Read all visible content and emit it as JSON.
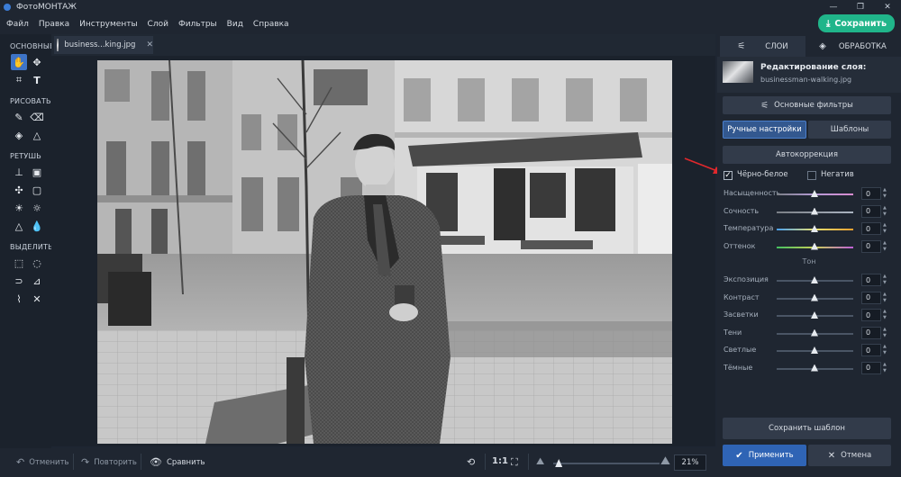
{
  "window": {
    "title": "ФотоМОНТАЖ",
    "controls": [
      "—",
      "❐",
      "✕"
    ]
  },
  "menu": {
    "items": [
      "Файл",
      "Правка",
      "Инструменты",
      "Слой",
      "Фильтры",
      "Вид",
      "Справка"
    ],
    "save_label": "Сохранить"
  },
  "tools": {
    "headings": [
      "ОСНОВНЫЕ",
      "РИСОВАТЬ",
      "РЕТУШЬ",
      "ВЫДЕЛИТЬ"
    ]
  },
  "document": {
    "tab_name": "business...king.jpg",
    "close_glyph": "✕"
  },
  "bottom": {
    "undo": "Отменить",
    "redo": "Повторить",
    "compare": "Сравнить",
    "ratio": "1:1",
    "zoom": "21%",
    "zoom_fraction": 0.02
  },
  "panel": {
    "tab_layers": "СЛОИ",
    "tab_processing": "ОБРАБОТКА",
    "layer_title": "Редактирование слоя:",
    "layer_file": "businessman-walking.jpg",
    "basic_filters": "Основные фильтры",
    "manual": "Ручные настройки",
    "templates": "Шаблоны",
    "auto": "Автокоррекция",
    "bw_label": "Чёрно-белое",
    "bw_checked": true,
    "negative_label": "Негатив",
    "negative_checked": false,
    "tone_label": "Тон",
    "color_sliders": [
      {
        "label": "Насыщенность",
        "value": "0"
      },
      {
        "label": "Сочность",
        "value": "0"
      },
      {
        "label": "Температура",
        "value": "0"
      },
      {
        "label": "Оттенок",
        "value": "0"
      }
    ],
    "tone_sliders": [
      {
        "label": "Экспозиция",
        "value": "0"
      },
      {
        "label": "Контраст",
        "value": "0"
      },
      {
        "label": "Засветки",
        "value": "0"
      },
      {
        "label": "Тени",
        "value": "0"
      },
      {
        "label": "Светлые",
        "value": "0"
      },
      {
        "label": "Тёмные",
        "value": "0"
      }
    ],
    "save_template": "Сохранить шаблон",
    "apply": "Применить",
    "cancel": "Отмена"
  },
  "colors": {
    "accent_green": "#20b58a",
    "accent_blue": "#2f64b5",
    "annotation_red": "#e0282c"
  }
}
